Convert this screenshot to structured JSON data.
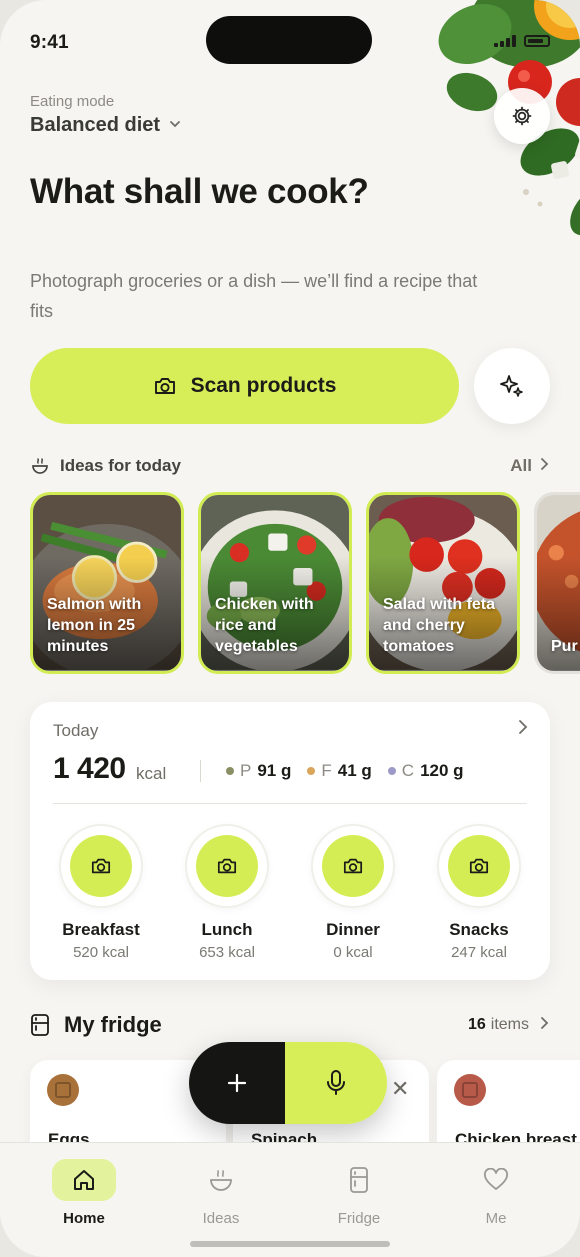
{
  "status": {
    "time": "9:41"
  },
  "header": {
    "mode_label": "Eating mode",
    "mode_value": "Balanced diet",
    "headline": "What shall we cook?",
    "subtext": "Photograph groceries or a dish — we’ll find a recipe that fits"
  },
  "scan": {
    "label": "Scan products"
  },
  "ideas": {
    "title": "Ideas for today",
    "all_label": "All",
    "cards": [
      {
        "caption": "Salmon with lemon in 25 minutes"
      },
      {
        "caption": "Chicken with rice and vegetables"
      },
      {
        "caption": "Salad with feta and cherry tomatoes"
      },
      {
        "caption": "Pur sou"
      }
    ]
  },
  "today": {
    "label": "Today",
    "kcal": "1 420",
    "kcal_unit": "kcal",
    "macros": [
      {
        "letter": "P",
        "value": "91 g",
        "color": "#8a8f63"
      },
      {
        "letter": "F",
        "value": "41 g",
        "color": "#d9a65b"
      },
      {
        "letter": "C",
        "value": "120 g",
        "color": "#9c9ac7"
      }
    ],
    "meals": [
      {
        "name": "Breakfast",
        "kcal": "520 kcal"
      },
      {
        "name": "Lunch",
        "kcal": "653 kcal"
      },
      {
        "name": "Dinner",
        "kcal": "0 kcal"
      },
      {
        "name": "Snacks",
        "kcal": "247 kcal"
      }
    ]
  },
  "fridge": {
    "title": "My fridge",
    "count": "16",
    "count_label": "items",
    "items": [
      {
        "name": "Eggs",
        "color": "#a9713a"
      },
      {
        "name": "Spinach",
        "color": "#5e8a3d"
      },
      {
        "name": "Chicken breast",
        "color": "#b85a4a"
      }
    ]
  },
  "tabs": [
    {
      "label": "Home",
      "active": true
    },
    {
      "label": "Ideas"
    },
    {
      "label": "Fridge"
    },
    {
      "label": "Me"
    }
  ],
  "colors": {
    "accent": "#d7ee59",
    "dark": "#151513",
    "background": "#f6f5f1"
  }
}
